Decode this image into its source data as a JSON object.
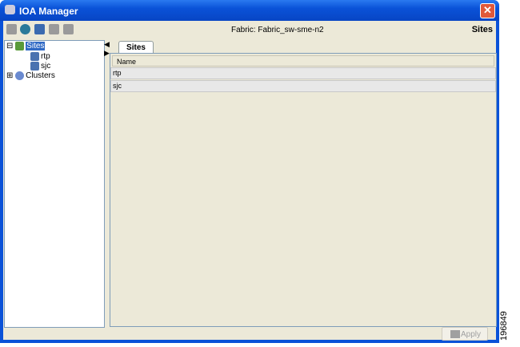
{
  "window": {
    "title": "IOA Manager",
    "close_label": "✕"
  },
  "header": {
    "fabric": "Fabric: Fabric_sw-sme-n2",
    "section": "Sites"
  },
  "tree": {
    "root": "Sites",
    "children": [
      "rtp",
      "sjc"
    ],
    "clusters": "Clusters",
    "expand": "⊟",
    "collapse": "⊞"
  },
  "tab": {
    "label": "Sites"
  },
  "table": {
    "header": "Name",
    "rows": [
      "rtp",
      "sjc"
    ]
  },
  "footer": {
    "apply_label": "Apply"
  },
  "watermark": "196849"
}
